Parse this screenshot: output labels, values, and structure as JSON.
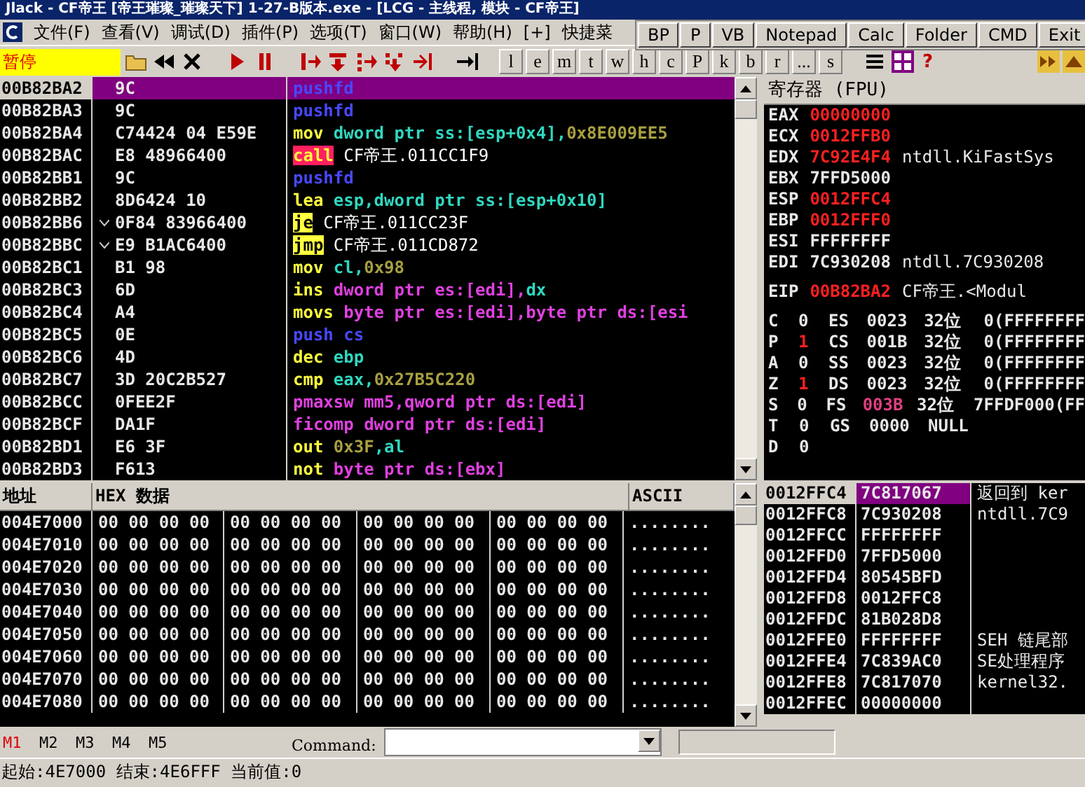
{
  "window": {
    "title": "Jlack - CF帝王 [帝王璀璨_璀璨天下] 1-27-B版本.exe - [LCG - 主线程, 模块 - CF帝王]"
  },
  "menu": [
    "文件(F)",
    "查看(V)",
    "调试(D)",
    "插件(P)",
    "选项(T)",
    "窗口(W)",
    "帮助(H)",
    "[+]",
    "快捷菜"
  ],
  "floating_toolbar": [
    "BP",
    "P",
    "VB",
    "Notepad",
    "Calc",
    "Folder",
    "CMD",
    "Exit"
  ],
  "status_box": "暂停",
  "letter_buttons": [
    "l",
    "e",
    "m",
    "t",
    "w",
    "h",
    "c",
    "P",
    "k",
    "b",
    "r",
    "...",
    "s"
  ],
  "help_button": "?",
  "cpu": {
    "rows": [
      {
        "address": "00B82BA2",
        "hex": "9C",
        "jump_arrow": false,
        "selected": true,
        "code": [
          {
            "t": "pushfd",
            "kind": "stk"
          }
        ]
      },
      {
        "address": "00B82BA3",
        "hex": "9C",
        "jump_arrow": false,
        "selected": false,
        "code": [
          {
            "t": "pushfd",
            "kind": "stk"
          }
        ]
      },
      {
        "address": "00B82BA4",
        "hex": "C74424 04 E59E",
        "jump_arrow": false,
        "selected": false,
        "code": [
          {
            "t": "mov ",
            "kind": "m"
          },
          {
            "t": "dword ptr ss:[esp+0x4],",
            "kind": "op"
          },
          {
            "t": "0x8E009EE5",
            "kind": "num"
          }
        ]
      },
      {
        "address": "00B82BAC",
        "hex": "E8 48966400",
        "jump_arrow": false,
        "selected": false,
        "code": [
          {
            "t": "call",
            "kind": "call"
          },
          {
            "t": " CF帝王.011CC1F9",
            "kind": "sym"
          }
        ]
      },
      {
        "address": "00B82BB1",
        "hex": "9C",
        "jump_arrow": false,
        "selected": false,
        "code": [
          {
            "t": "pushfd",
            "kind": "stk"
          }
        ]
      },
      {
        "address": "00B82BB2",
        "hex": "8D6424 10",
        "jump_arrow": false,
        "selected": false,
        "code": [
          {
            "t": "lea ",
            "kind": "m"
          },
          {
            "t": "esp,dword ptr ss:[esp+0x10]",
            "kind": "op"
          }
        ]
      },
      {
        "address": "00B82BB6",
        "hex": "0F84 83966400",
        "jump_arrow": true,
        "selected": false,
        "code": [
          {
            "t": "je",
            "kind": "jmp"
          },
          {
            "t": " CF帝王.011CC23F",
            "kind": "sym"
          }
        ]
      },
      {
        "address": "00B82BBC",
        "hex": "E9 B1AC6400",
        "jump_arrow": true,
        "selected": false,
        "code": [
          {
            "t": "jmp",
            "kind": "jmp"
          },
          {
            "t": " CF帝王.011CD872",
            "kind": "sym"
          }
        ]
      },
      {
        "address": "00B82BC1",
        "hex": "B1 98",
        "jump_arrow": false,
        "selected": false,
        "code": [
          {
            "t": "mov ",
            "kind": "m"
          },
          {
            "t": "cl,",
            "kind": "op"
          },
          {
            "t": "0x98",
            "kind": "num"
          }
        ]
      },
      {
        "address": "00B82BC3",
        "hex": "6D",
        "jump_arrow": false,
        "selected": false,
        "code": [
          {
            "t": "ins ",
            "kind": "m"
          },
          {
            "t": "dword ptr es:[edi],",
            "kind": "mem"
          },
          {
            "t": "dx",
            "kind": "op"
          }
        ]
      },
      {
        "address": "00B82BC4",
        "hex": "A4",
        "jump_arrow": false,
        "selected": false,
        "code": [
          {
            "t": "movs ",
            "kind": "m"
          },
          {
            "t": "byte ptr es:[edi],byte ptr ds:[esi",
            "kind": "mem"
          }
        ]
      },
      {
        "address": "00B82BC5",
        "hex": "0E",
        "jump_arrow": false,
        "selected": false,
        "code": [
          {
            "t": "push cs",
            "kind": "stk"
          }
        ]
      },
      {
        "address": "00B82BC6",
        "hex": "4D",
        "jump_arrow": false,
        "selected": false,
        "code": [
          {
            "t": "dec ",
            "kind": "m"
          },
          {
            "t": "ebp",
            "kind": "op"
          }
        ]
      },
      {
        "address": "00B82BC7",
        "hex": "3D 20C2B527",
        "jump_arrow": false,
        "selected": false,
        "code": [
          {
            "t": "cmp ",
            "kind": "m"
          },
          {
            "t": "eax,",
            "kind": "op"
          },
          {
            "t": "0x27B5C220",
            "kind": "num"
          }
        ]
      },
      {
        "address": "00B82BCC",
        "hex": "0FEE2F",
        "jump_arrow": false,
        "selected": false,
        "code": [
          {
            "t": "pmaxsw mm5,qword ptr ds:[edi]",
            "kind": "mem"
          }
        ]
      },
      {
        "address": "00B82BCF",
        "hex": "DA1F",
        "jump_arrow": false,
        "selected": false,
        "code": [
          {
            "t": "ficomp dword ptr ds:[edi]",
            "kind": "mem"
          }
        ]
      },
      {
        "address": "00B82BD1",
        "hex": "E6 3F",
        "jump_arrow": false,
        "selected": false,
        "code": [
          {
            "t": "out ",
            "kind": "m"
          },
          {
            "t": "0x3F",
            "kind": "num"
          },
          {
            "t": ",al",
            "kind": "op"
          }
        ]
      },
      {
        "address": "00B82BD3",
        "hex": "F613",
        "jump_arrow": false,
        "selected": false,
        "code": [
          {
            "t": "not ",
            "kind": "m"
          },
          {
            "t": "byte ptr ds:[ebx]",
            "kind": "mem"
          }
        ]
      }
    ]
  },
  "registers": {
    "title": "寄存器 (FPU)",
    "general": [
      {
        "name": "EAX",
        "value": "00000000",
        "changed": true
      },
      {
        "name": "ECX",
        "value": "0012FFB0",
        "changed": true
      },
      {
        "name": "EDX",
        "value": "7C92E4F4",
        "changed": true,
        "comment": "ntdll.KiFastSys"
      },
      {
        "name": "EBX",
        "value": "7FFD5000",
        "changed": false
      },
      {
        "name": "ESP",
        "value": "0012FFC4",
        "changed": true
      },
      {
        "name": "EBP",
        "value": "0012FFF0",
        "changed": true
      },
      {
        "name": "ESI",
        "value": "FFFFFFFF",
        "changed": false
      },
      {
        "name": "EDI",
        "value": "7C930208",
        "changed": false,
        "comment": "ntdll.7C930208"
      }
    ],
    "eip": {
      "name": "EIP",
      "value": "00B82BA2",
      "changed": true,
      "comment": "CF帝王.<Modul"
    },
    "flags": [
      {
        "flag": "C",
        "bit": "0",
        "bit_changed": false,
        "segment": "ES",
        "selector": "0023",
        "selector_changed": false,
        "size": "32位",
        "base": "0(FFFFFFFF"
      },
      {
        "flag": "P",
        "bit": "1",
        "bit_changed": true,
        "segment": "CS",
        "selector": "001B",
        "selector_changed": false,
        "size": "32位",
        "base": "0(FFFFFFFF"
      },
      {
        "flag": "A",
        "bit": "0",
        "bit_changed": false,
        "segment": "SS",
        "selector": "0023",
        "selector_changed": false,
        "size": "32位",
        "base": "0(FFFFFFFF"
      },
      {
        "flag": "Z",
        "bit": "1",
        "bit_changed": true,
        "segment": "DS",
        "selector": "0023",
        "selector_changed": false,
        "size": "32位",
        "base": "0(FFFFFFFF"
      },
      {
        "flag": "S",
        "bit": "0",
        "bit_changed": false,
        "segment": "FS",
        "selector": "003B",
        "selector_changed": true,
        "size": "32位",
        "base": "7FFDF000(FF"
      },
      {
        "flag": "T",
        "bit": "0",
        "bit_changed": false,
        "segment": "GS",
        "selector": "0000",
        "selector_changed": false,
        "size": "NULL"
      },
      {
        "flag": "D",
        "bit": "0",
        "bit_changed": false
      }
    ]
  },
  "dump": {
    "columns": [
      "地址",
      "HEX 数据",
      "ASCII"
    ],
    "rows": [
      {
        "address": "004E7000",
        "groups": [
          "00 00 00 00",
          "00 00 00 00",
          "00 00 00 00",
          "00 00 00 00"
        ],
        "ascii": "........"
      },
      {
        "address": "004E7010",
        "groups": [
          "00 00 00 00",
          "00 00 00 00",
          "00 00 00 00",
          "00 00 00 00"
        ],
        "ascii": "........"
      },
      {
        "address": "004E7020",
        "groups": [
          "00 00 00 00",
          "00 00 00 00",
          "00 00 00 00",
          "00 00 00 00"
        ],
        "ascii": "........"
      },
      {
        "address": "004E7030",
        "groups": [
          "00 00 00 00",
          "00 00 00 00",
          "00 00 00 00",
          "00 00 00 00"
        ],
        "ascii": "........"
      },
      {
        "address": "004E7040",
        "groups": [
          "00 00 00 00",
          "00 00 00 00",
          "00 00 00 00",
          "00 00 00 00"
        ],
        "ascii": "........"
      },
      {
        "address": "004E7050",
        "groups": [
          "00 00 00 00",
          "00 00 00 00",
          "00 00 00 00",
          "00 00 00 00"
        ],
        "ascii": "........"
      },
      {
        "address": "004E7060",
        "groups": [
          "00 00 00 00",
          "00 00 00 00",
          "00 00 00 00",
          "00 00 00 00"
        ],
        "ascii": "........"
      },
      {
        "address": "004E7070",
        "groups": [
          "00 00 00 00",
          "00 00 00 00",
          "00 00 00 00",
          "00 00 00 00"
        ],
        "ascii": "........"
      },
      {
        "address": "004E7080",
        "groups": [
          "00 00 00 00",
          "00 00 00 00",
          "00 00 00 00",
          "00 00 00 00"
        ],
        "ascii": "........"
      }
    ]
  },
  "stack": {
    "rows": [
      {
        "address": "0012FFC4",
        "value": "7C817067",
        "comment": "返回到 ker",
        "selected": true
      },
      {
        "address": "0012FFC8",
        "value": "7C930208",
        "comment": "ntdll.7C9",
        "selected": false
      },
      {
        "address": "0012FFCC",
        "value": "FFFFFFFF",
        "selected": false
      },
      {
        "address": "0012FFD0",
        "value": "7FFD5000",
        "selected": false
      },
      {
        "address": "0012FFD4",
        "value": "80545BFD",
        "selected": false
      },
      {
        "address": "0012FFD8",
        "value": "0012FFC8",
        "selected": false
      },
      {
        "address": "0012FFDC",
        "value": "81B028D8",
        "selected": false
      },
      {
        "address": "0012FFE0",
        "value": "FFFFFFFF",
        "comment": "SEH 链尾部",
        "selected": false
      },
      {
        "address": "0012FFE4",
        "value": "7C839AC0",
        "comment": "SE处理程序",
        "selected": false
      },
      {
        "address": "0012FFE8",
        "value": "7C817070",
        "comment": "kernel32.",
        "selected": false
      },
      {
        "address": "0012FFEC",
        "value": "00000000",
        "selected": false
      }
    ]
  },
  "memory_tabs": [
    {
      "label": "M1",
      "selected": true
    },
    {
      "label": "M2",
      "selected": false
    },
    {
      "label": "M3",
      "selected": false
    },
    {
      "label": "M4",
      "selected": false
    },
    {
      "label": "M5",
      "selected": false
    }
  ],
  "command": {
    "label": "Command:"
  },
  "status_bar": "起始:4E7000 结束:4E6FFF 当前值:0"
}
